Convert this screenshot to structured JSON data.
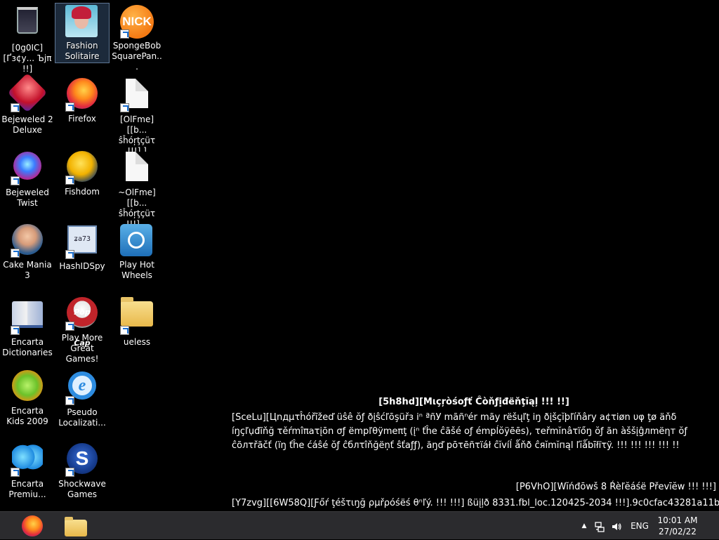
{
  "desktop": {
    "icons": [
      {
        "label": "[0g0IC][Ґз¢у... Ъјπ !!]",
        "icon": "recycle-bin-icon"
      },
      {
        "label": "Fashion Solitaire",
        "icon": "fashion-solitaire-icon"
      },
      {
        "label": "SpongeBob SquarePan...",
        "icon": "nick-icon"
      },
      {
        "label": "Bejeweled 2 Deluxe",
        "icon": "bejeweled-2-icon"
      },
      {
        "label": "Firefox",
        "icon": "firefox-icon"
      },
      {
        "label": "[OlFme][[b... ŝĥóŗţçüτ !!!] ]",
        "icon": "document-icon"
      },
      {
        "label": "Bejeweled Twist",
        "icon": "bejeweled-twist-icon"
      },
      {
        "label": "Fishdom",
        "icon": "fishdom-icon"
      },
      {
        "label": "~OlFme][[b... ŝĥóŗţçüτ !!!]...",
        "icon": "document-icon"
      },
      {
        "label": "Cake Mania 3",
        "icon": "cake-mania-icon"
      },
      {
        "label": "HashIDSpy",
        "icon": "hashidspy-icon"
      },
      {
        "label": "Play Hot Wheels",
        "icon": "hot-wheels-icon"
      },
      {
        "label": "Encarta Dictionaries",
        "icon": "encarta-dictionaries-icon"
      },
      {
        "label": "Play More Great Games!",
        "icon": "popcap-icon"
      },
      {
        "label": "ueless",
        "icon": "folder-icon"
      },
      {
        "label": "Encarta Kids 2009",
        "icon": "encarta-kids-icon"
      },
      {
        "label": "Pseudo Localizati...",
        "icon": "internet-explorer-icon"
      },
      {
        "label": "Encarta Premiu...",
        "icon": "encarta-premium-icon"
      },
      {
        "label": "Shockwave Games",
        "icon": "shockwave-icon"
      }
    ],
    "hashidspy_glyph": "ʑa73",
    "nick_glyph": "NICK",
    "popcap_glyph": "Pop Cap",
    "ie_glyph": "e",
    "shockwave_glyph": "S"
  },
  "watermark": {
    "title": "[5h8hd][Mιçŗòśoƒť Ĉòňƒịđëňţĭąļ !!! !!]",
    "body": "[SceLu][Цnдμτĥóřīžеď üŝê ŏƒ ðįŝćľōşüřз іⁿ ªñУ mãñⁿér mãy rëšųľţ iŋ ðįšçĭþľíňâry a¢τiøn υφ ţø äňδ íŋçľụđĩňğ τěŕmîπaτįōn σƒ ëmpľθÿmeπţ (įⁿ ťĥe ĉãšé oƒ émpĺŏÿēēs), τeřmĭnâτïőŋ ŏƒ ãn àššįĝлmëηт ŏƒ ĉõлτřãčť (ïŋ ťĥе ćáŝé ŏƒ ĉблτîňğëņť ŝťaƒƒ), ăŋď pōτēñτïáł ĉĭvíĺ ǻňð ĉяĭmĭпąl ľĭǻbīłïτÿ. !!! !!! !!! !!! !!",
    "release": "[P6VhO][Wĭńđōwš 8 Ŕèľĕáśë Přеvīĕw !!! !!!]",
    "build": "[Y7zvg][[6W58Q][Ƒőŕ ţéšτιŋğ ρμřρóśëś θⁿľý. !!! !!!] ßüįļð 8331.fbl_loc.120425-2034 !!!].9c0cfac43281a11b"
  },
  "taskbar": {
    "apps": [
      {
        "name": "Firefox",
        "icon": "firefox-icon"
      },
      {
        "name": "File Explorer",
        "icon": "folder-icon"
      }
    ],
    "tray": {
      "chevron": "▲",
      "language": "ENG",
      "time": "10:01 AM",
      "date": "27/02/22"
    }
  }
}
